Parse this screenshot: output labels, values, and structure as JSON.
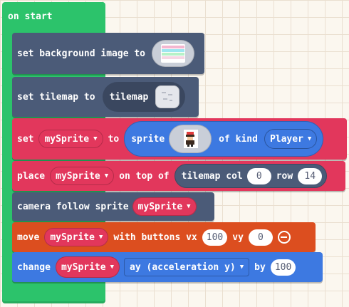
{
  "on_start": {
    "label": "on start"
  },
  "blocks": {
    "set_background": {
      "text": "set background image to",
      "image_icon": "rainbow-gradient-image-icon"
    },
    "set_tilemap": {
      "text": "set tilemap to",
      "dropdown": "tilemap",
      "tile_icon": "tilemap-preview-icon"
    },
    "set_sprite": {
      "set_text": "set",
      "var": "mySprite",
      "to_text": "to",
      "sprite_text": "sprite",
      "sprite_icon": "player-sprite-icon",
      "of_kind_text": "of kind",
      "kind": "Player"
    },
    "place": {
      "place_text": "place",
      "var": "mySprite",
      "on_top_text": "on top of",
      "col_text": "tilemap col",
      "col": "0",
      "row_text": "row",
      "row": "14"
    },
    "camera": {
      "text": "camera follow sprite",
      "var": "mySprite"
    },
    "move": {
      "move_text": "move",
      "var": "mySprite",
      "with_text": "with buttons vx",
      "vx": "100",
      "vy_text": "vy",
      "vy": "0",
      "remove_icon": "minus-circle-icon"
    },
    "change": {
      "change_text": "change",
      "var": "mySprite",
      "property": "ay (acceleration y)",
      "by_text": "by",
      "value": "100"
    }
  },
  "colors": {
    "events": "#2cc36b",
    "scene": "#4b5b78",
    "sprites": "#e2375c",
    "controller": "#dc4e1f",
    "physics": "#3d79e1"
  }
}
